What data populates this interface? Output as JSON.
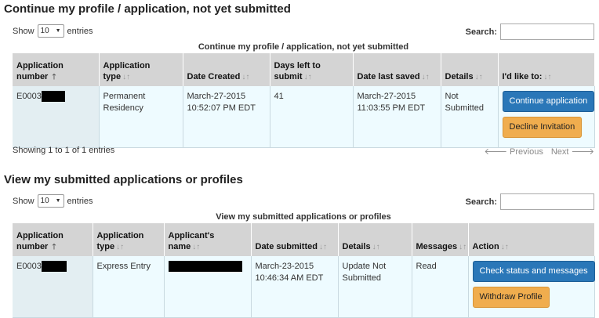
{
  "section1": {
    "title": "Continue my profile / application, not yet submitted",
    "show_label": "Show",
    "entries_value": "10",
    "entries_label": "entries",
    "search_label": "Search:",
    "caption": "Continue my profile / application, not yet submitted",
    "headers": [
      "Application number",
      "Application type",
      "Date Created",
      "Days left to submit",
      "Date last saved",
      "Details",
      "I'd like to:"
    ],
    "row": {
      "app_number": "E0003",
      "app_type": "Permanent Residency",
      "date_created": "March-27-2015 10:52:07 PM EDT",
      "days_left": "41",
      "date_saved": "March-27-2015 11:03:55 PM EDT",
      "details": "Not Submitted",
      "btn_continue": "Continue application",
      "btn_decline": "Decline Invitation"
    },
    "info": "Showing 1 to 1 of 1 entries",
    "prev": "Previous",
    "next": "Next"
  },
  "section2": {
    "title": "View my submitted applications or profiles",
    "show_label": "Show",
    "entries_value": "10",
    "entries_label": "entries",
    "search_label": "Search:",
    "caption": "View my submitted applications or profiles",
    "headers": [
      "Application number",
      "Application type",
      "Applicant's name",
      "Date submitted",
      "Details",
      "Messages",
      "Action"
    ],
    "row": {
      "app_number": "E0003",
      "app_type": "Express Entry",
      "date_submitted": "March-23-2015 10:46:34 AM EDT",
      "details": "Update Not Submitted",
      "messages": "Read",
      "btn_check": "Check status and messages",
      "btn_withdraw": "Withdraw Profile"
    }
  }
}
